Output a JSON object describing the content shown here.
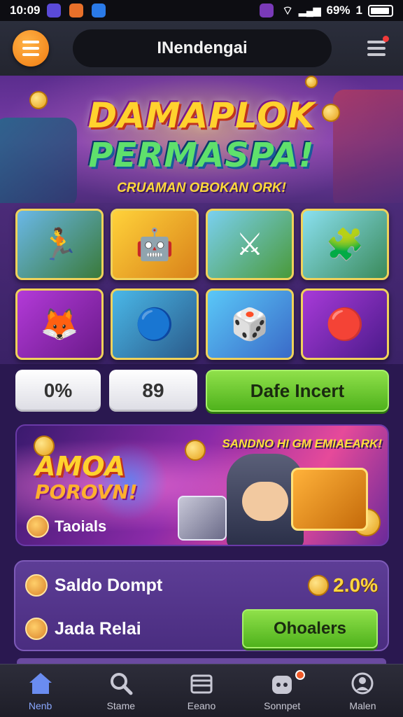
{
  "status_bar": {
    "time": "10:09",
    "battery": "69%",
    "signal_label": "1"
  },
  "header": {
    "title": "INendengai"
  },
  "hero": {
    "title_line1": "DAMAPLOK",
    "title_line2": "PERMASPA!",
    "subtitle": "CRUAMAN OBOKAN ORK!"
  },
  "games": [
    {
      "icon": "adventure-game-icon"
    },
    {
      "icon": "robot-game-icon"
    },
    {
      "icon": "battle-game-icon"
    },
    {
      "icon": "puzzle-game-icon"
    },
    {
      "icon": "hero-game-icon"
    },
    {
      "icon": "cannon-game-icon"
    },
    {
      "icon": "dice-game-icon"
    },
    {
      "icon": "orb-game-icon"
    }
  ],
  "stats": {
    "stat1": "0%",
    "stat2": "89",
    "action_label": "Dafe Incert"
  },
  "promo": {
    "tag": "SANDNO HI GM EMIAEARK!",
    "title_line1": "AMOA",
    "title_line2": "POROVN!",
    "footer_label": "Taoials"
  },
  "wallet": {
    "balance_label": "Saldo Dompt",
    "balance_value": "2.0%",
    "reward_label": "Jada Relai",
    "claim_label": "Ohoalers"
  },
  "nav": [
    {
      "label": "Nenb",
      "icon": "home-icon"
    },
    {
      "label": "Stame",
      "icon": "search-icon"
    },
    {
      "label": "Eeano",
      "icon": "wallet-icon"
    },
    {
      "label": "Sonnpet",
      "icon": "gamepad-icon"
    },
    {
      "label": "Malen",
      "icon": "profile-icon"
    }
  ],
  "colors": {
    "accent_green": "#4fb21c",
    "accent_orange": "#f07a10",
    "panel_purple": "#4a2d80",
    "active_nav": "#8aa8ff"
  }
}
